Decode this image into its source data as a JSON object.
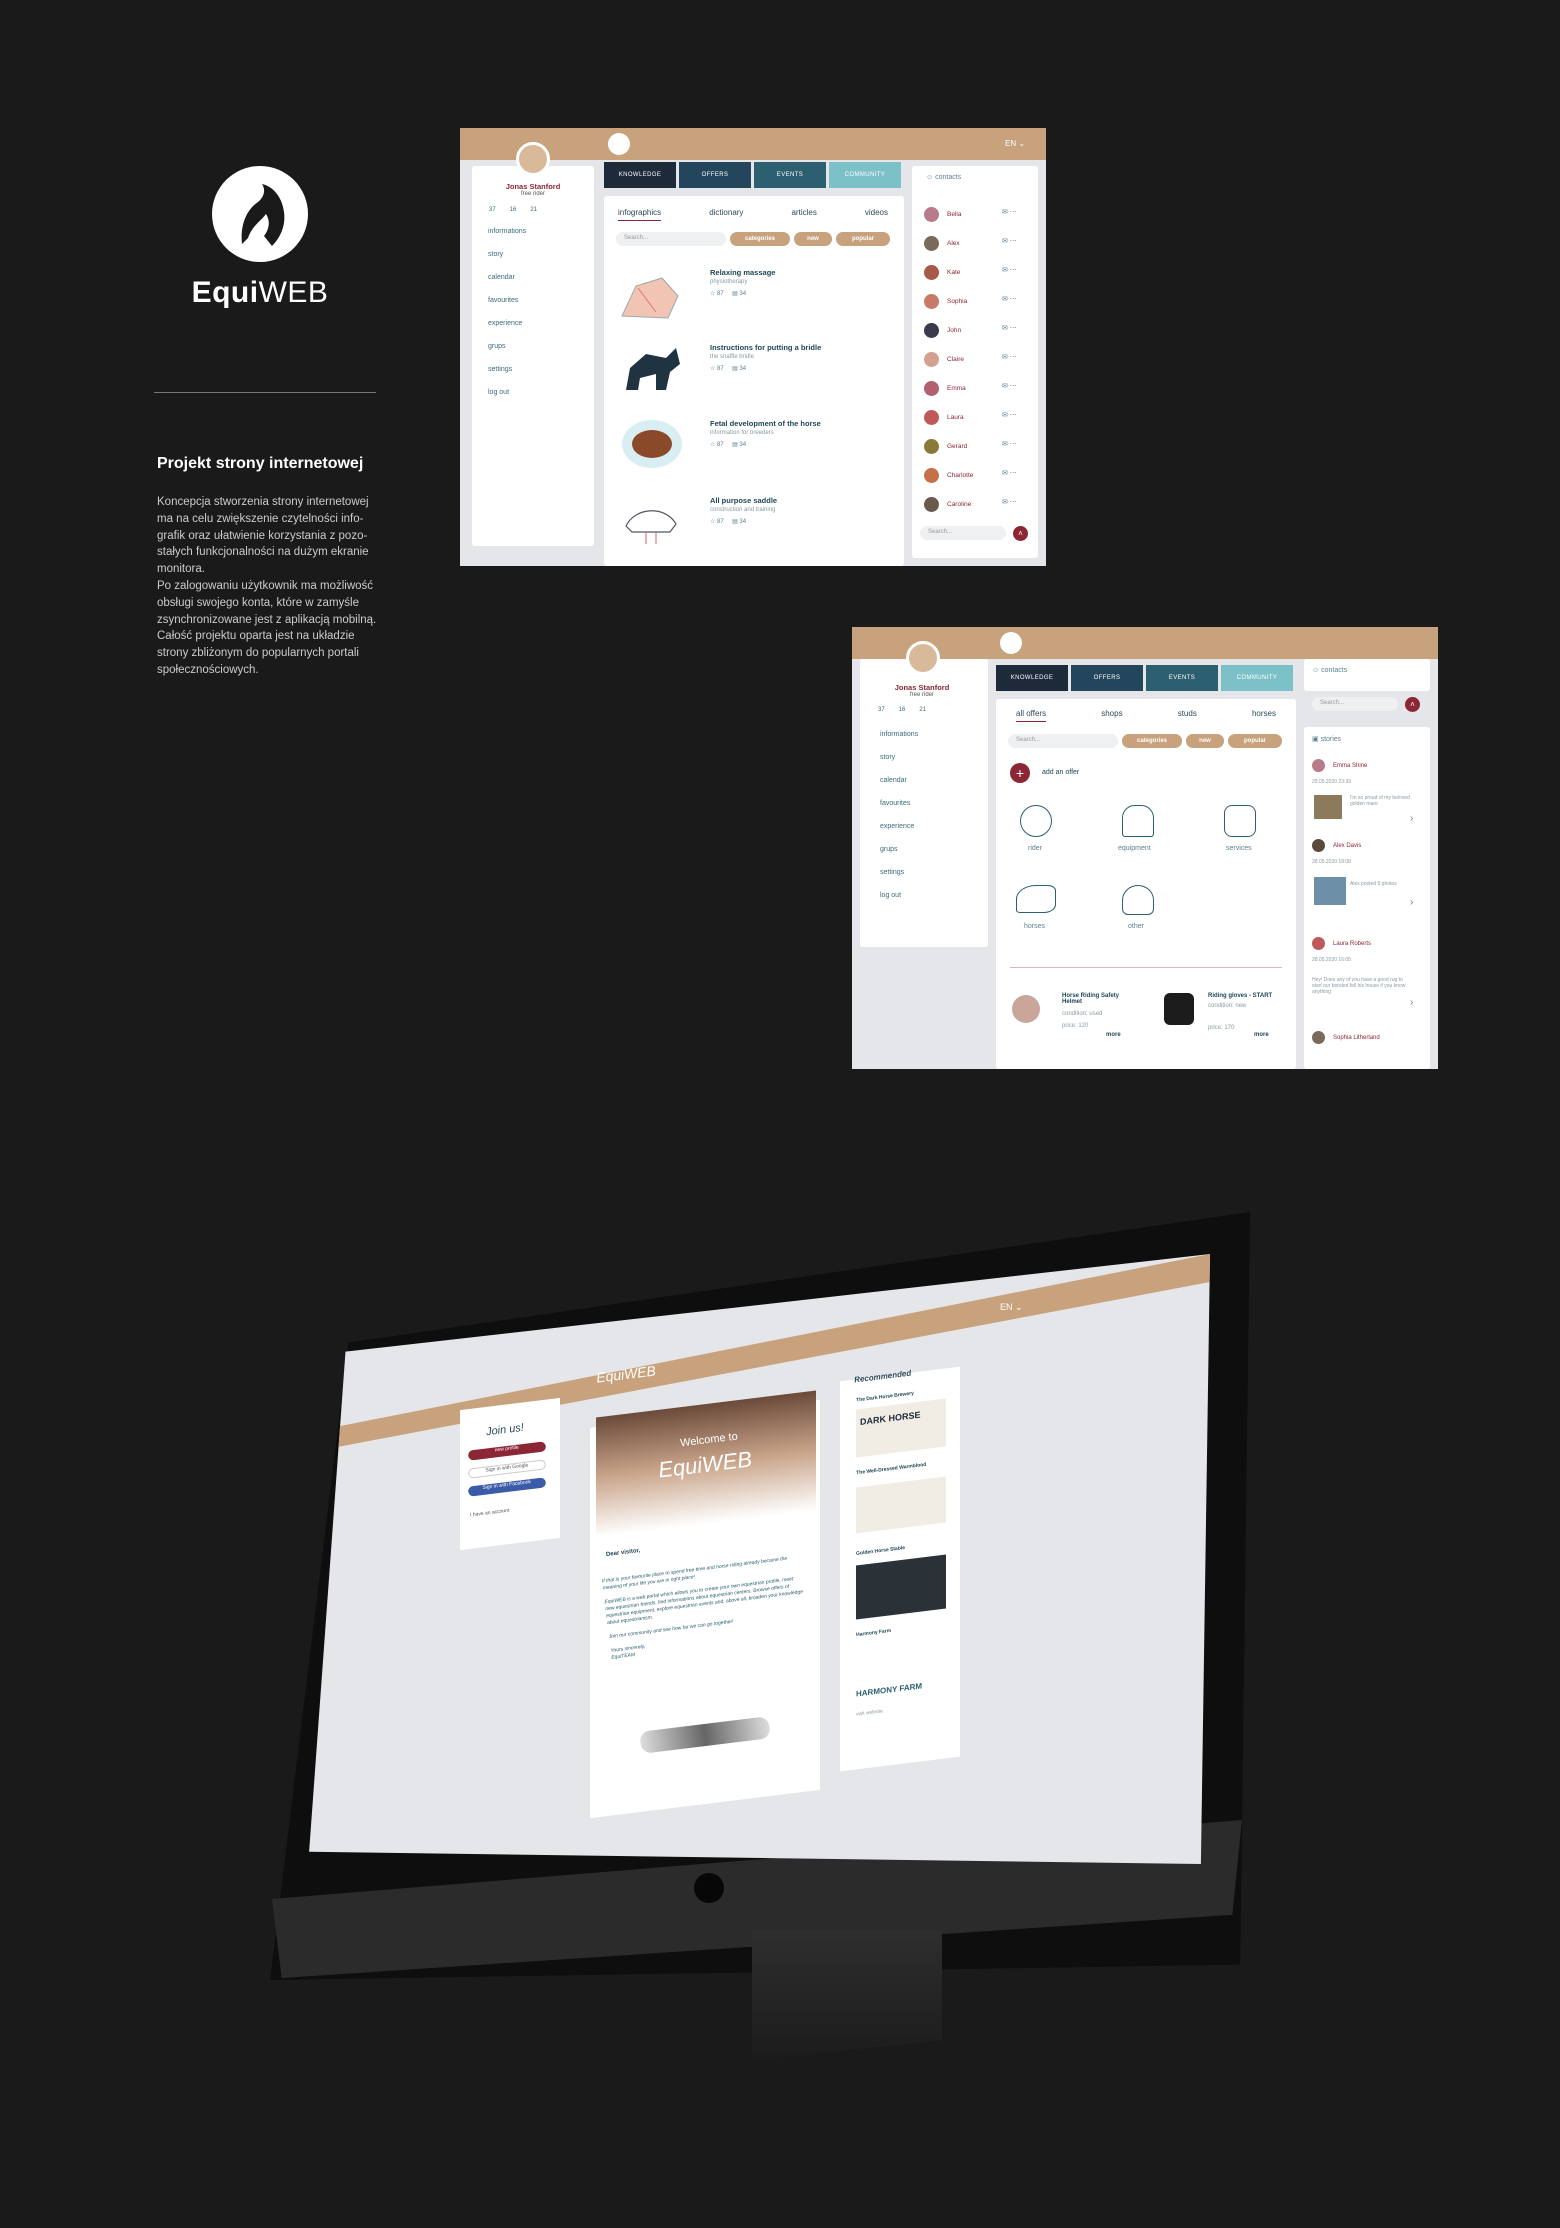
{
  "brand": {
    "name_bold": "Equi",
    "name_light": "WEB"
  },
  "project": {
    "title": "Projekt strony internetowej",
    "desc": [
      "Koncepcja stworzenia strony internetowej ma na celu zwiększenie czytelności info-grafik oraz ułatwienie korzystania z pozo-stałych funkcjonalności na dużym ekranie monitora.",
      "Po zalogowaniu użytkownik ma możliwość obsługi swojego konta, które w zamyśle zsynchronizowane jest z aplikacją mobilną.",
      "Całość projektu oparta jest na układzie strony zbliżonym do popularnych portali społecznościowych."
    ]
  },
  "user": {
    "name": "Jonas Stanford",
    "role": "free rider",
    "stats": [
      "37",
      "16",
      "21"
    ]
  },
  "menu": [
    "informations",
    "story",
    "calendar",
    "favourites",
    "experience",
    "grups",
    "settings",
    "log out"
  ],
  "tabs": [
    "KNOWLEDGE",
    "OFFERS",
    "EVENTS",
    "COMMUNITY"
  ],
  "lang": "EN",
  "knowledge": {
    "subtabs": [
      "infographics",
      "dictionary",
      "articles",
      "videos"
    ],
    "search": "Search...",
    "pills": [
      "categories",
      "new",
      "popular"
    ],
    "items": [
      {
        "title": "Relaxing massage",
        "sub": "physiotherapy",
        "stars": "87",
        "comments": "34"
      },
      {
        "title": "Instructions for putting a bridle",
        "sub": "the snaffle bridle",
        "stars": "87",
        "comments": "34"
      },
      {
        "title": "Fetal development  of the horse",
        "sub": "information for breeders",
        "stars": "87",
        "comments": "34"
      },
      {
        "title": "All purpose saddle",
        "sub": "construction and training",
        "stars": "87",
        "comments": "34"
      }
    ]
  },
  "contacts": {
    "title": "contacts",
    "names": [
      "Bella",
      "Alex",
      "Kate",
      "Sophia",
      "John",
      "Claire",
      "Emma",
      "Laura",
      "Gerard",
      "Charlotte",
      "Caroline"
    ],
    "search": "Search..."
  },
  "offers": {
    "subtabs": [
      "all offers",
      "shops",
      "studs",
      "horses"
    ],
    "search": "Search...",
    "pills": [
      "categories",
      "new",
      "popular"
    ],
    "add": "add an offer",
    "categories": [
      "rider",
      "equipment",
      "services",
      "horses",
      "other"
    ],
    "products": [
      {
        "title": "Horse Riding Safety Helmet",
        "sub": "condition: used",
        "price": "price: 120",
        "more": "more"
      },
      {
        "title": "Riding gloves - START",
        "sub": "condition: new",
        "price": "price: 170",
        "more": "more"
      }
    ]
  },
  "stories": {
    "title": "stories",
    "posts": [
      {
        "name": "Emma Shine",
        "date": "29.05.2020 23:39",
        "text": "I'm so proud of my beloved golden mare"
      },
      {
        "name": "Alex Davis",
        "date": "28.05.2020 18:08",
        "text": "Alex posted 9 photos"
      },
      {
        "name": "Laura Roberts",
        "date": "28.05.2020 16:05",
        "text": "Hey! Does any of you have a good rug to start our bonded fell his house if you know anything"
      },
      {
        "name": "Sophia Litherland",
        "date": "",
        "text": ""
      }
    ]
  },
  "home": {
    "logo": "EquiWEB",
    "join": "Join us!",
    "buttons": [
      "new profile",
      "Sign in with Google",
      "Sign in with Facebook"
    ],
    "have_account": "I have an account",
    "welcome_small": "Welcome to",
    "welcome_big": "EquiWEB",
    "dear": "Dear visitor,",
    "body": [
      "If that is your favourite place to spend free time and horse riding already became the meaning of your life you are in right place!",
      "EquiWEB is a web portal which allows you to create your own equestrian profile, meet new equestrian friends, find informations about equestrian centers. Browse offers of equestrian equipment, explore equestrian events and, above all, broaden your knowledge about equestrianism.",
      "Join our community and see how far we can go together!",
      "Yours sincerely,",
      "EquiTEAM"
    ],
    "recommended": "Recommended",
    "rec_items": [
      "The Dark Horse Brewery",
      "The Well-Dressed Warmblood",
      "Golden Horse Stable",
      "Harmony Farm"
    ],
    "rec_logo_dark": "DARK HORSE",
    "rec_logo_harmony": "HARMONY FARM",
    "visit": "visit website"
  }
}
